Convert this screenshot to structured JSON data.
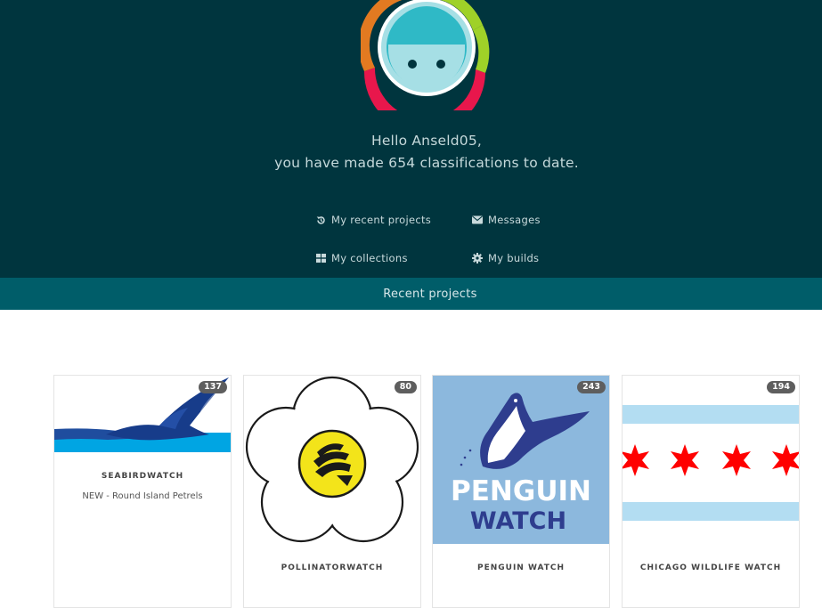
{
  "user": {
    "greeting": "Hello Anseld05,",
    "summary": "you have made 654 classifications to date."
  },
  "nav": {
    "recent_projects": "My recent projects",
    "messages": "Messages",
    "collections": "My collections",
    "builds": "My builds"
  },
  "tabs": {
    "active": "Recent projects"
  },
  "projects": [
    {
      "name": "SEABIRDWATCH",
      "count": "137",
      "description": "NEW - Round Island Petrels"
    },
    {
      "name": "POLLINATORWATCH",
      "count": "80",
      "description": ""
    },
    {
      "name": "PENGUIN WATCH",
      "count": "243",
      "description": "",
      "logo_line1": "PENGUIN",
      "logo_line2": "WATCH"
    },
    {
      "name": "CHICAGO WILDLIFE WATCH",
      "count": "194",
      "description": ""
    }
  ],
  "colors": {
    "hero_bg": "#00353e",
    "tab_bg": "#005d69",
    "avatar_face": "#2fb9c6",
    "ring_orange": "#e27a21",
    "ring_green": "#9fd128",
    "ring_red": "#e8174c"
  }
}
